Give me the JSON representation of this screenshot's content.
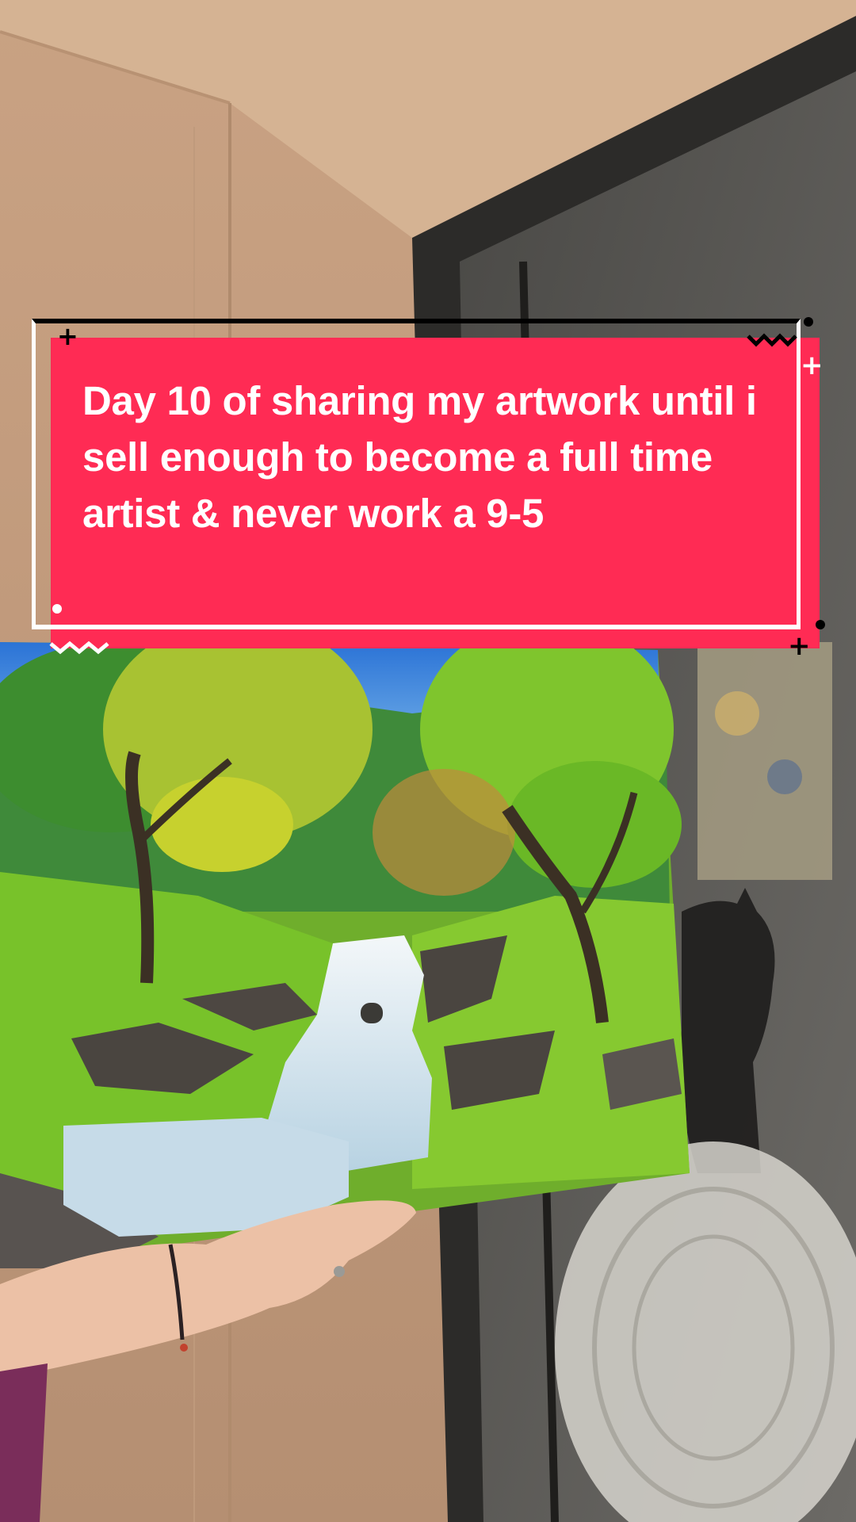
{
  "caption": {
    "text": "Day 10 of sharing my artwork until i sell enough to become a full time artist & never work a 9-5",
    "colors": {
      "background": "#ff2b54",
      "text": "#ffffff",
      "frame_top": "#000000",
      "frame_sides": "#ffffff"
    }
  },
  "scene": {
    "subject": "acrylic landscape painting of a waterfall and trees held up by a hand",
    "colors": {
      "wall": "#c9a585",
      "door_frame": "#2b2a28",
      "screen_dark": "#3a3a38",
      "sky": "#2f7fd8",
      "foliage": "#7ec42a",
      "water": "#e9f2f6"
    }
  }
}
